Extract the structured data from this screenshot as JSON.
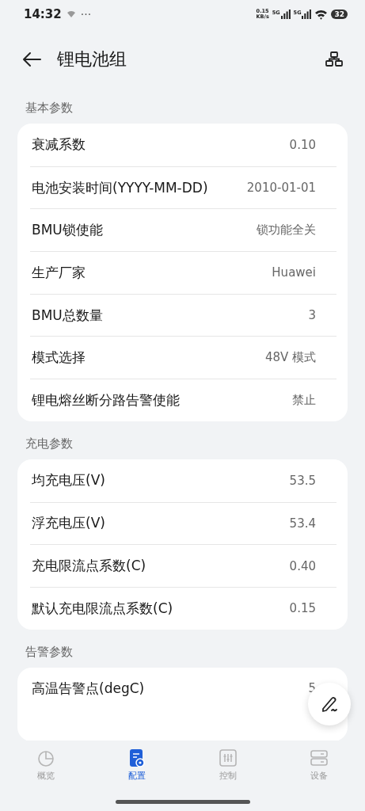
{
  "status_bar": {
    "time": "14:32",
    "more": "···",
    "speed": "0.15",
    "speed_unit": "KB/s",
    "networks": [
      "5G",
      "5G"
    ],
    "battery": "32"
  },
  "header": {
    "title": "锂电池组"
  },
  "sections": [
    {
      "title": "基本参数",
      "rows": [
        {
          "label": "衰减系数",
          "value": "0.10"
        },
        {
          "label": "电池安装时间(YYYY-MM-DD)",
          "value": "2010-01-01"
        },
        {
          "label": "BMU锁使能",
          "value": "锁功能全关"
        },
        {
          "label": "生产厂家",
          "value": "Huawei"
        },
        {
          "label": "BMU总数量",
          "value": "3"
        },
        {
          "label": "模式选择",
          "value": "48V 模式"
        },
        {
          "label": "锂电熔丝断分路告警使能",
          "value": "禁止"
        }
      ]
    },
    {
      "title": "充电参数",
      "rows": [
        {
          "label": "均充电压(V)",
          "value": "53.5"
        },
        {
          "label": "浮充电压(V)",
          "value": "53.4"
        },
        {
          "label": "充电限流点系数(C)",
          "value": "0.40"
        },
        {
          "label": "默认充电限流点系数(C)",
          "value": "0.15"
        }
      ]
    },
    {
      "title": "告警参数",
      "rows": [
        {
          "label": "高温告警点(degC)",
          "value": "5"
        }
      ]
    }
  ],
  "tabs": [
    {
      "label": "概览",
      "selected": false
    },
    {
      "label": "配置",
      "selected": true
    },
    {
      "label": "控制",
      "selected": false
    },
    {
      "label": "设备",
      "selected": false
    }
  ]
}
